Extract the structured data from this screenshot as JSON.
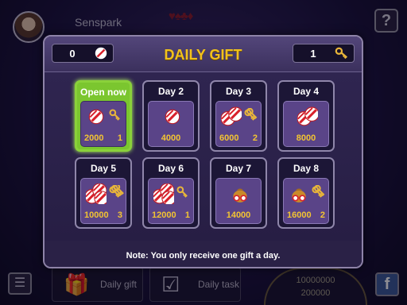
{
  "top_bar": {
    "username": "Senspark",
    "suits": "♥♠♣♦",
    "help_label": "?"
  },
  "bottom_bar": {
    "daily_gift_label": "Daily gift",
    "daily_task_label": "Daily task",
    "jackpot_line1": "10000000",
    "jackpot_line2": "200000",
    "facebook_label": "f"
  },
  "modal": {
    "title": "DAILY GIFT",
    "coin_count": "0",
    "key_count": "1",
    "note": "Note: You only receive one gift a day."
  },
  "days": [
    {
      "label": "Open now",
      "coins": "2000",
      "keys": "1",
      "active": true
    },
    {
      "label": "Day 2",
      "coins": "4000",
      "keys": ""
    },
    {
      "label": "Day 3",
      "coins": "6000",
      "keys": "2"
    },
    {
      "label": "Day 4",
      "coins": "8000",
      "keys": ""
    },
    {
      "label": "Day 5",
      "coins": "10000",
      "keys": "3"
    },
    {
      "label": "Day 6",
      "coins": "12000",
      "keys": "1"
    },
    {
      "label": "Day 7",
      "coins": "14000",
      "keys": ""
    },
    {
      "label": "Day 8",
      "coins": "16000",
      "keys": "2"
    }
  ],
  "colors": {
    "title_gold": "#f2c21b",
    "active_green": "#7bc62f",
    "amount_gold": "#f3c432"
  },
  "icons": {
    "coin": "candy-chip-icon",
    "key": "key-icon",
    "bag": "coin-bag-icon"
  }
}
